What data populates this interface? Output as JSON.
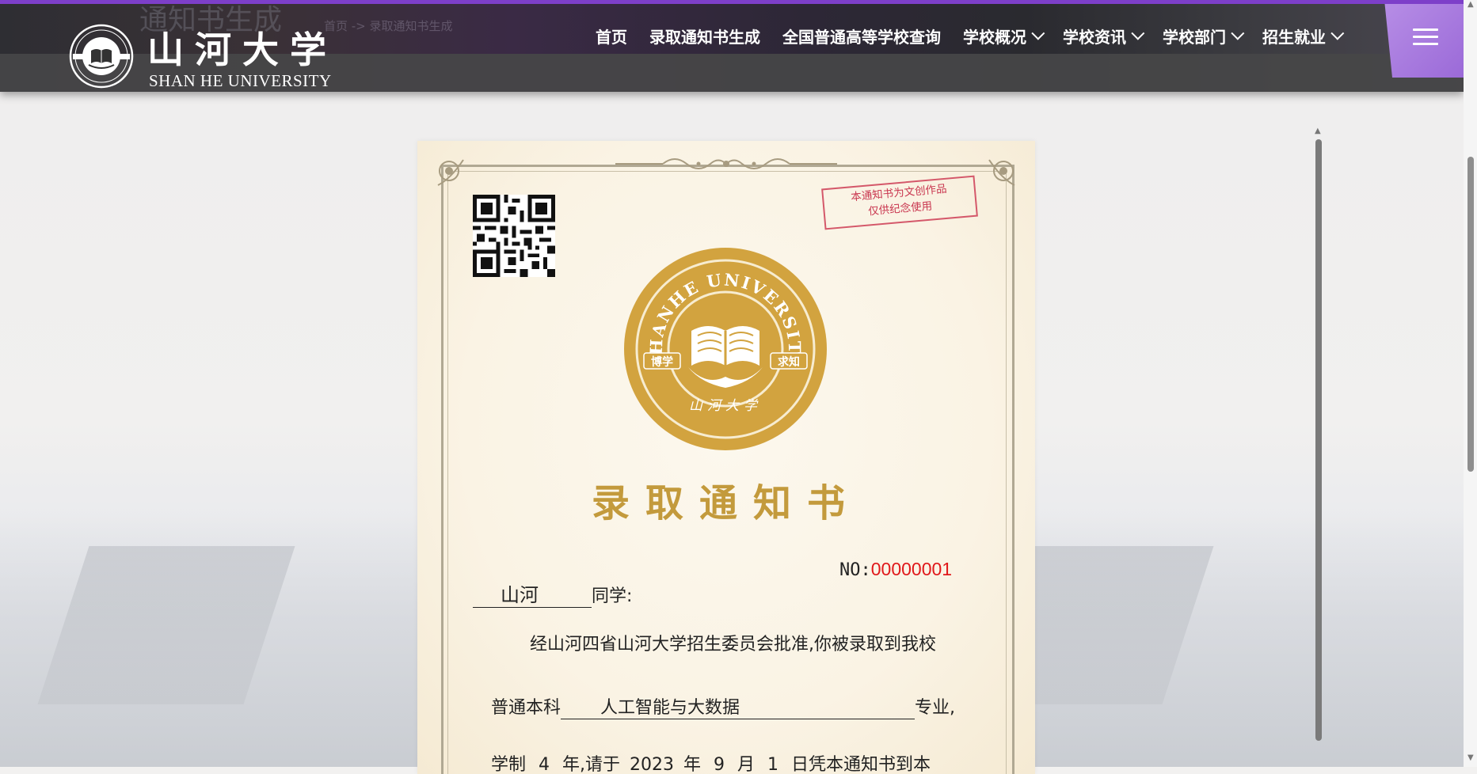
{
  "page_header": {
    "ghost_title": "通知书生成",
    "breadcrumb": "首页 -> 录取通知书生成"
  },
  "logo": {
    "name_cn": "山河大学",
    "name_en": "SHAN HE   UNIVERSITY",
    "emblem_text": "SHANHE UNIVERSITY",
    "emblem_left": "博学",
    "emblem_right": "求知",
    "emblem_bottom": "山河大学"
  },
  "nav": {
    "items": [
      {
        "label": "首页",
        "dropdown": false
      },
      {
        "label": "录取通知书生成",
        "dropdown": false
      },
      {
        "label": "全国普通高等学校查询",
        "dropdown": false
      },
      {
        "label": "学校概况",
        "dropdown": true
      },
      {
        "label": "学校资讯",
        "dropdown": true
      },
      {
        "label": "学校部门",
        "dropdown": true
      },
      {
        "label": "招生就业",
        "dropdown": true
      }
    ],
    "menu_icon": "hamburger-icon"
  },
  "certificate": {
    "stamp_line1": "本通知书为文创作品",
    "stamp_line2": "仅供纪念使用",
    "seal_text": "SHANHE UNIVERSITY",
    "seal_left": "博学",
    "seal_right": "求知",
    "seal_bottom": "山河大学",
    "title": "录取通知书",
    "no_label": "NO:",
    "no_value": "00000001",
    "student_name": "山河",
    "student_suffix": "同学:",
    "line1": "经山河四省山河大学招生委员会批准,你被录取到我校",
    "major_prefix": "普通本科",
    "major": "人工智能与大数据",
    "major_suffix": "专业,",
    "line3_a": "学制",
    "years": "4",
    "line3_b": "年,请于",
    "year": "2023",
    "line3_c": "年",
    "month": "9",
    "line3_d": "月",
    "day": "1",
    "line3_e": "日凭本通知书到本"
  },
  "colors": {
    "accent_purple": "#7d3fc9",
    "gold": "#c39a3c",
    "stamp_red": "#c9364f",
    "number_red": "#e0181a"
  }
}
